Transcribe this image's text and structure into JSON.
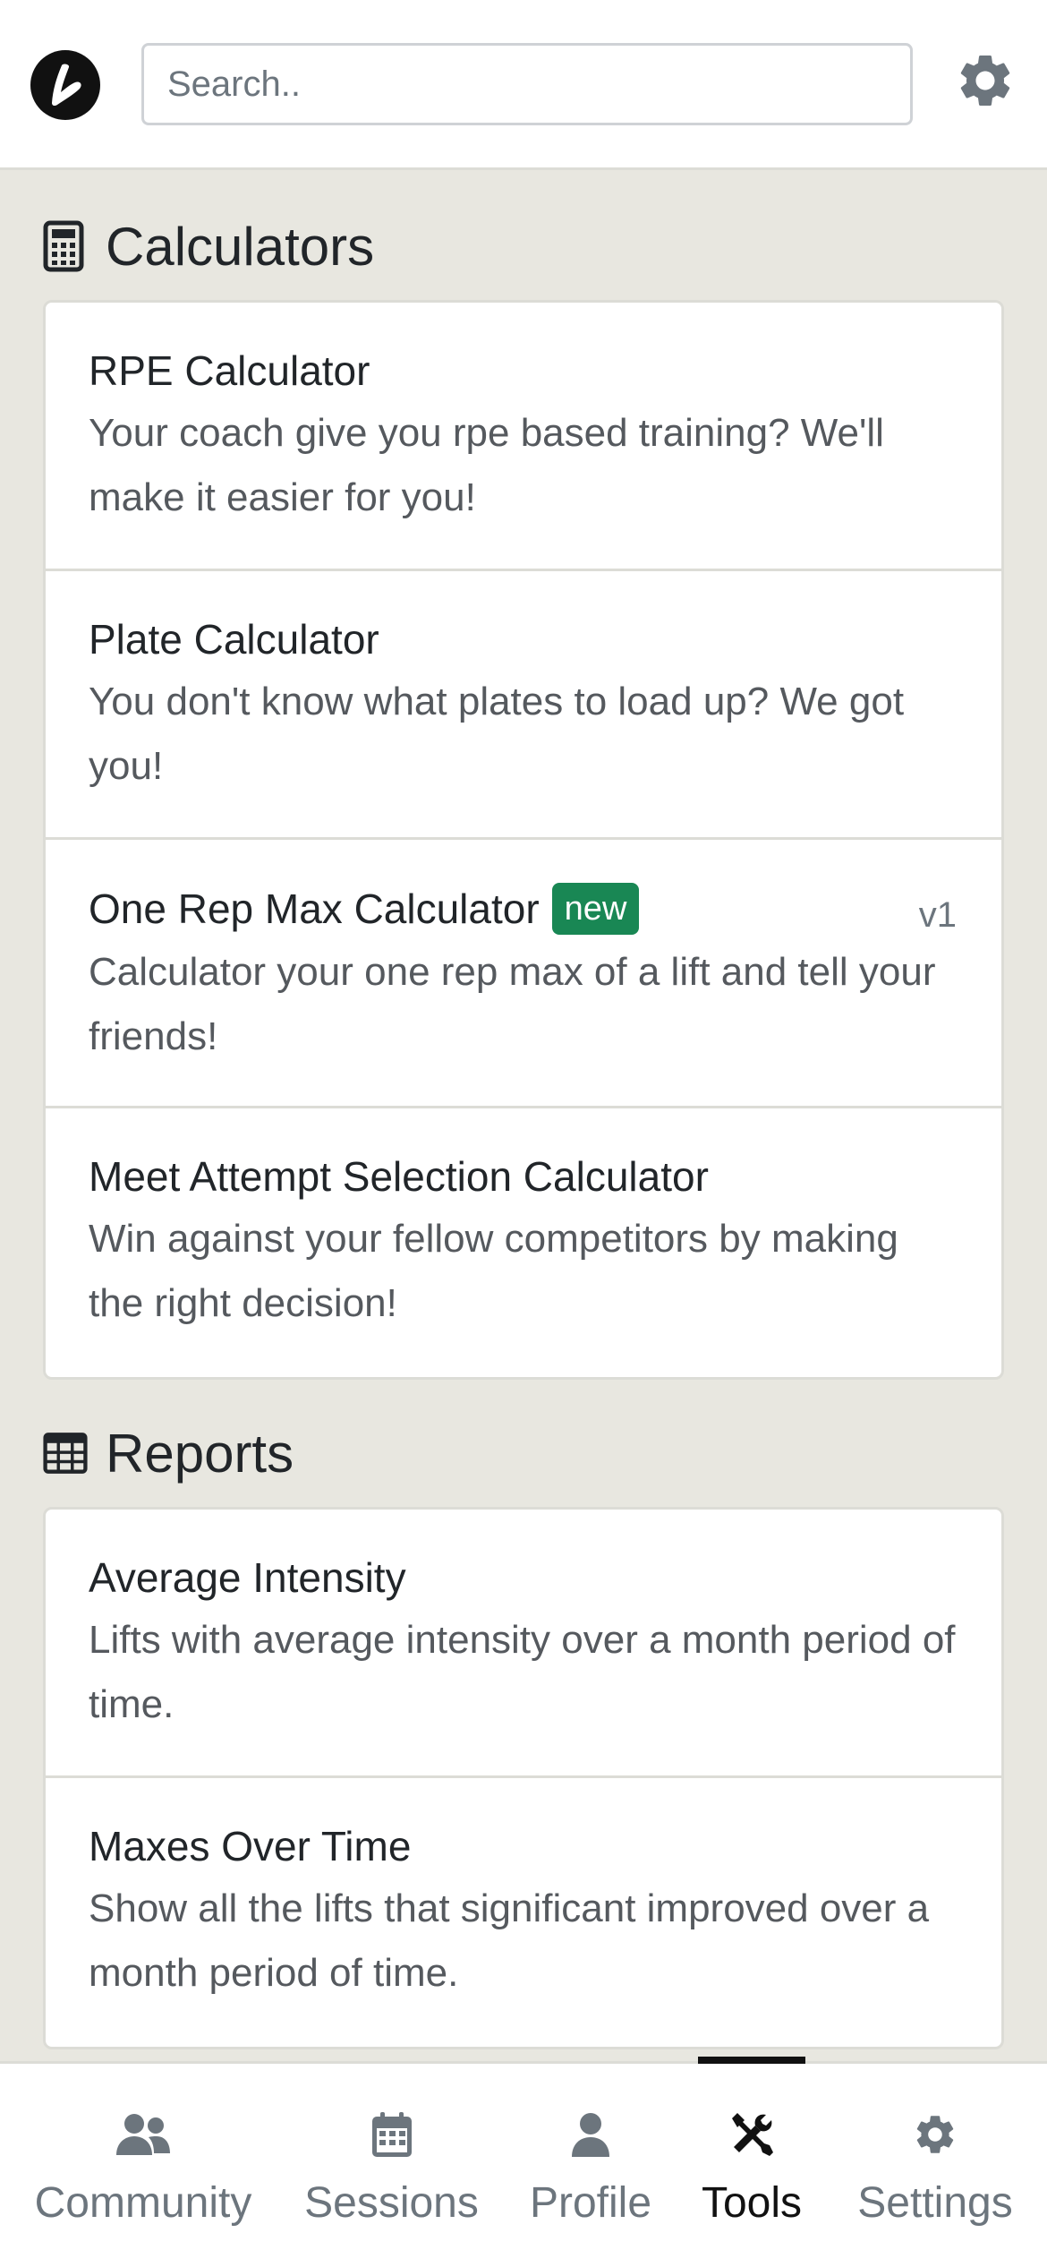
{
  "header": {
    "search_placeholder": "Search..",
    "logo_icon": "brand-logo-icon",
    "settings_icon": "gear-icon"
  },
  "calculators": {
    "title": "Calculators",
    "icon": "calculator-icon",
    "items": [
      {
        "title": "RPE Calculator",
        "desc": "Your coach give you rpe based training? We'll make it easier for you!"
      },
      {
        "title": "Plate Calculator",
        "desc": "You don't know what plates to load up? We got you!"
      },
      {
        "title": "One Rep Max Calculator",
        "badge": "new",
        "version": "v1",
        "desc": "Calculator your one rep max of a lift and tell your friends!"
      },
      {
        "title": "Meet Attempt Selection Calculator",
        "desc": "Win against your fellow competitors by making the right decision!"
      }
    ]
  },
  "reports": {
    "title": "Reports",
    "icon": "table-icon",
    "items": [
      {
        "title": "Average Intensity",
        "desc": "Lifts with average intensity over a month period of time."
      },
      {
        "title": "Maxes Over Time",
        "desc": "Show all the lifts that significant improved over a month period of time."
      }
    ]
  },
  "nav": {
    "items": [
      {
        "label": "Community",
        "icon": "users-icon"
      },
      {
        "label": "Sessions",
        "icon": "calendar-icon"
      },
      {
        "label": "Profile",
        "icon": "user-icon"
      },
      {
        "label": "Tools",
        "icon": "tools-icon"
      },
      {
        "label": "Settings",
        "icon": "gear-icon"
      }
    ],
    "active": "Tools"
  },
  "colors": {
    "accent_badge": "#198754",
    "page_bg": "#e8e7e0",
    "text": "#212529",
    "muted": "#6c757d"
  }
}
